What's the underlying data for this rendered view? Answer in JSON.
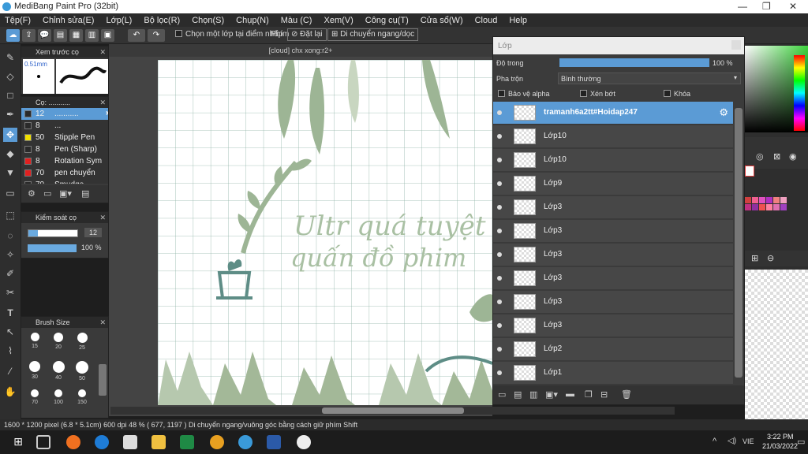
{
  "app": {
    "title": "MediBang Paint Pro (32bit)"
  },
  "menu": [
    "Tệp(F)",
    "Chỉnh sửa(E)",
    "Lớp(L)",
    "Bộ lọc(R)",
    "Chọn(S)",
    "Chụp(N)",
    "Màu (C)",
    "Xem(V)",
    "Công cụ(T)",
    "Cửa sổ(W)",
    "Cloud",
    "Help"
  ],
  "toolbar": {
    "select_layer_label": "Chọn một lớp tại điểm nhấp",
    "phim_label": "Phím",
    "reset_label": "Đặt lại",
    "move_label": "Di chuyển ngang/dọc"
  },
  "preview": {
    "title": "Xem trước cọ",
    "size": "0.51mm"
  },
  "brush_panel": {
    "title": "Cọ: ...........",
    "items": [
      {
        "size": "12",
        "name": "...........",
        "color": "#2a2a2a"
      },
      {
        "size": "8",
        "name": "...",
        "color": "#2a2a2a"
      },
      {
        "size": "50",
        "name": "Stipple Pen",
        "color": "#f0e000"
      },
      {
        "size": "8",
        "name": "Pen (Sharp)",
        "color": "#2a2a2a"
      },
      {
        "size": "8",
        "name": "Rotation Sym",
        "color": "#e02020"
      },
      {
        "size": "70",
        "name": "pen chuyển",
        "color": "#e02020"
      },
      {
        "size": "70",
        "name": "Smudge",
        "color": "#2a2a2a"
      }
    ]
  },
  "brush_control": {
    "title": "Kiểm soát cọ",
    "size": "12",
    "opacity": "100 %"
  },
  "brush_size": {
    "title": "Brush Size",
    "sizes": [
      "15",
      "20",
      "25",
      "30",
      "40",
      "50",
      "70",
      "100",
      "150"
    ]
  },
  "canvas": {
    "tab_title": "[cloud] chx xong:r2+",
    "text_line1": "Ultr quá tuyệt v",
    "text_line2": "quấn đồ phim"
  },
  "layer_panel": {
    "title": "Lớp",
    "opacity_label": "Độ trong",
    "opacity_value": "100 %",
    "opacity_fraction": 1.0,
    "blend_label": "Pha trộn",
    "blend_value": "Bình thường",
    "protect_alpha": "Bảo vệ alpha",
    "clip": "Xén bớt",
    "lock": "Khóa",
    "layers": [
      "tramanh6a2tt#Hoidap247",
      "Lớp10",
      "Lớp10",
      "Lớp9",
      "Lớp3",
      "Lớp3",
      "Lớp3",
      "Lớp3",
      "Lớp3",
      "Lớp3",
      "Lớp2",
      "Lớp1"
    ]
  },
  "status": {
    "text": "1600 * 1200 pixel   (6.8 * 5.1cm)   600 dpi   48 %   ( 677, 1197 )   Di chuyển ngang/vuông góc bằng cách giữ phím Shift"
  },
  "taskbar": {
    "lang": "VIE",
    "time": "3:22 PM",
    "date": "21/03/2022"
  },
  "colors": {
    "accent": "#5b9bd5",
    "plant": "#a3b898",
    "plant_dark": "#7f9c86",
    "pot": "#5e8d86"
  },
  "palette": [
    "#d04040",
    "#f06090",
    "#e050c0",
    "#b030c0",
    "#f08080",
    "#f0a0c0",
    "#c03080",
    "#9030a0",
    "#f05050",
    "#ff80a0",
    "#e070b0",
    "#a040c0"
  ]
}
